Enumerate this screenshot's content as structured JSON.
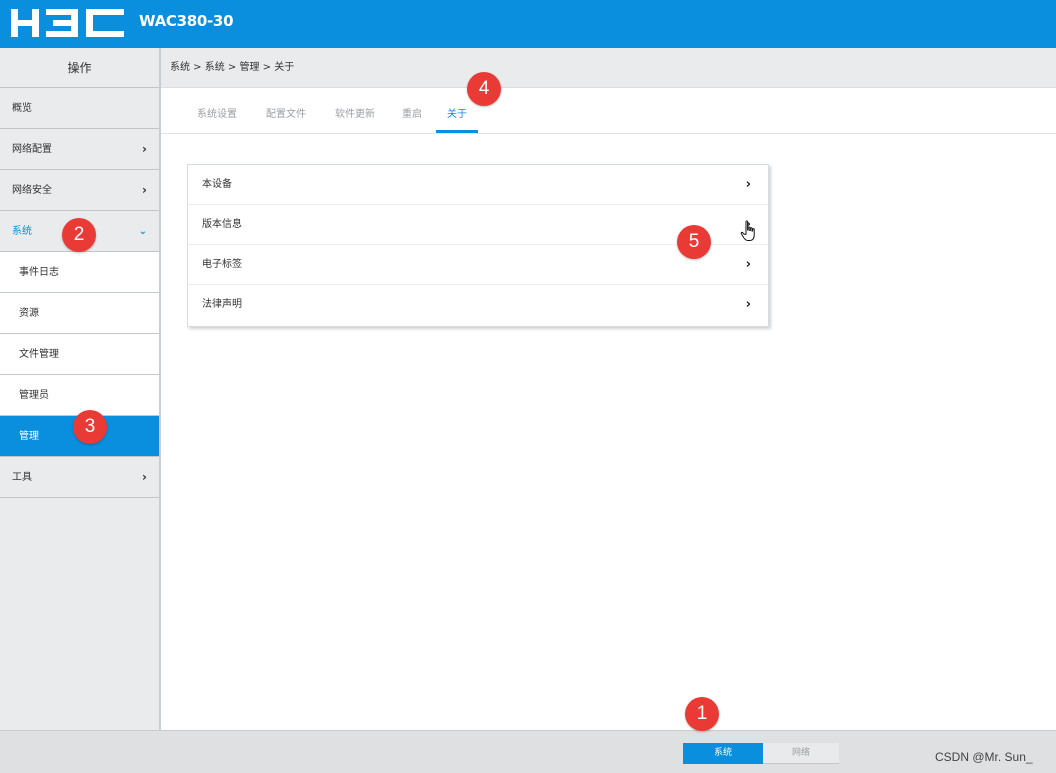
{
  "header": {
    "brand": "H3C",
    "model": "WAC380-30",
    "bg_color": "#0a8ede"
  },
  "sidebar": {
    "title": "操作",
    "items": [
      {
        "label": "概览",
        "icon": ""
      },
      {
        "label": "网络配置",
        "icon": "chevron-right-icon",
        "glyph": "›"
      },
      {
        "label": "网络安全",
        "icon": "chevron-right-icon",
        "glyph": "›"
      },
      {
        "label": "系统",
        "icon": "chevron-down-icon",
        "glyph": "⌄",
        "expanded": true
      },
      {
        "label": "工具",
        "icon": "chevron-right-icon",
        "glyph": "›"
      }
    ],
    "system_children": [
      {
        "label": "事件日志"
      },
      {
        "label": "资源"
      },
      {
        "label": "文件管理"
      },
      {
        "label": "管理员"
      },
      {
        "label": "管理",
        "active": true
      }
    ]
  },
  "breadcrumb": "系统 > 系统 > 管理 > 关于",
  "tabs": [
    {
      "label": "系统设置"
    },
    {
      "label": "配置文件"
    },
    {
      "label": "软件更新"
    },
    {
      "label": "重启"
    },
    {
      "label": "关于",
      "active": true
    }
  ],
  "about_panel": {
    "rows": [
      {
        "label": "本设备",
        "glyph": "›"
      },
      {
        "label": "版本信息",
        "glyph": "›"
      },
      {
        "label": "电子标签",
        "glyph": "›"
      },
      {
        "label": "法律声明",
        "glyph": "›"
      }
    ]
  },
  "footer": {
    "system_button": "系统",
    "network_button": "网络",
    "watermark": "CSDN @Mr. Sun_"
  },
  "markers": [
    "1",
    "2",
    "3",
    "4",
    "5"
  ],
  "colors": {
    "accent": "#0a8ede",
    "marker": "#ea3a36"
  }
}
